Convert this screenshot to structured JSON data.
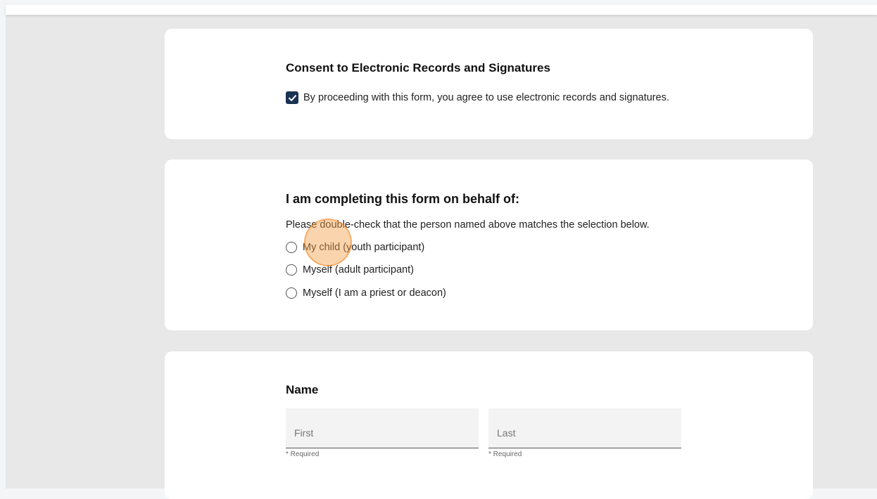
{
  "consent": {
    "title": "Consent to Electronic Records and Signatures",
    "checkbox_label": "By proceeding with this form, you agree to use electronic records and signatures.",
    "checked": true,
    "check_color": "#1a3352"
  },
  "behalf": {
    "title": "I am completing this form on behalf of:",
    "hint": "Please double-check that the person named above matches the selection below.",
    "options": [
      {
        "label": "My child (youth participant)",
        "selected": false
      },
      {
        "label": "Myself (adult participant)",
        "selected": false
      },
      {
        "label": "Myself (I am a priest or deacon)",
        "selected": false
      }
    ]
  },
  "name": {
    "title": "Name",
    "first": {
      "placeholder": "First",
      "value": "",
      "helper": "* Required"
    },
    "last": {
      "placeholder": "Last",
      "value": "",
      "helper": "* Required"
    }
  },
  "icons": {
    "checkbox": "checkmark-icon",
    "radio": "radio-empty-icon"
  }
}
